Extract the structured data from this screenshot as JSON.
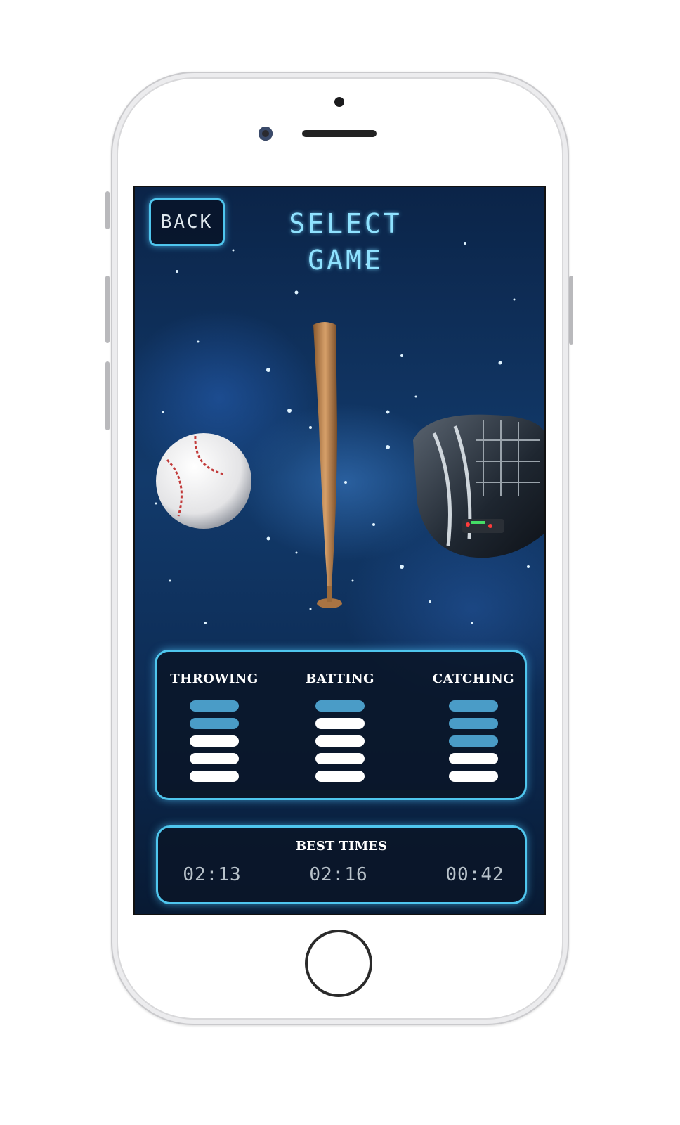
{
  "header": {
    "back_label": "BACK",
    "title": "SELECT GAME"
  },
  "games": [
    {
      "label": "THROWING",
      "icon": "baseball-icon",
      "level": 2,
      "max_level": 5
    },
    {
      "label": "BATTING",
      "icon": "bat-icon",
      "level": 1,
      "max_level": 5
    },
    {
      "label": "CATCHING",
      "icon": "glove-icon",
      "level": 3,
      "max_level": 5
    }
  ],
  "best_times": {
    "label": "BEST TIMES",
    "values": [
      "02:13",
      "02:16",
      "00:42"
    ]
  },
  "colors": {
    "accent": "#4fc6ee",
    "bar_lit": "#4a9cc7",
    "bar_unlit": "#ffffff"
  }
}
